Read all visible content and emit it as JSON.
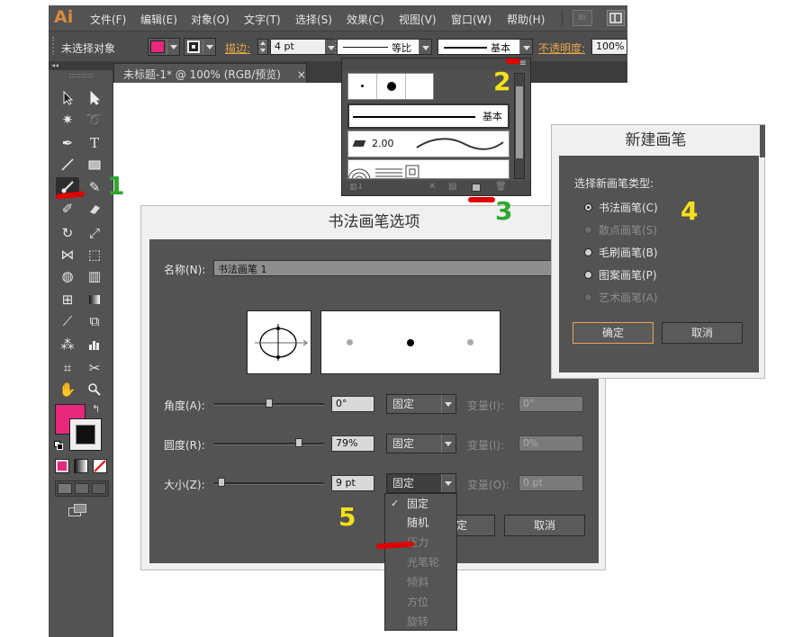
{
  "menubar": {
    "logo": "Ai",
    "items": [
      "文件(F)",
      "编辑(E)",
      "对象(O)",
      "文字(T)",
      "选择(S)",
      "效果(C)",
      "视图(V)",
      "窗口(W)",
      "帮助(H)"
    ],
    "bridge_label": "Br"
  },
  "controlbar": {
    "selection_status": "未选择对象",
    "stroke_label": "描边:",
    "stroke_weight": "4 pt",
    "profile_label": "等比",
    "brush_label": "基本",
    "opacity_label": "不透明度:",
    "opacity_value": "100%",
    "fill_color": "#e8287c"
  },
  "document": {
    "tab_title": "未标题-1* @ 100% (RGB/预览)",
    "close_glyph": "×"
  },
  "brush_panel": {
    "basic_label": "基本",
    "stroke_value": "2.00",
    "menu_glyph": "≡"
  },
  "calligraphic_dialog": {
    "title": "书法画笔选项",
    "name_label": "名称(N):",
    "name_value": "书法画笔 1",
    "angle": {
      "label": "角度(A):",
      "value": "0°",
      "mode": "固定",
      "variation_label": "变量(I):",
      "variation_value": "0°",
      "slider_level": 0.5
    },
    "roundness": {
      "label": "圆度(R):",
      "value": "79%",
      "mode": "固定",
      "variation_label": "变量(I):",
      "variation_value": "0%",
      "slider_level": 0.79
    },
    "size": {
      "label": "大小(Z):",
      "value": "9 pt",
      "mode": "固定",
      "variation_label": "变量(O):",
      "variation_value": "0 pt",
      "slider_level": 0.04
    },
    "ok_partial": "定",
    "cancel_button": "取消",
    "size_menu": {
      "options": [
        "固定",
        "随机",
        "压力",
        "光笔轮",
        "倾斜",
        "方位",
        "旋转"
      ],
      "selected_index": 0,
      "enabled_count": 2,
      "check_glyph": "✓"
    }
  },
  "new_brush_dialog": {
    "title": "新建画笔",
    "prompt": "选择新画笔类型:",
    "options": [
      {
        "label": "书法画笔(C)",
        "enabled": true,
        "checked": true
      },
      {
        "label": "散点画笔(S)",
        "enabled": false,
        "checked": false
      },
      {
        "label": "毛刷画笔(B)",
        "enabled": true,
        "checked": false
      },
      {
        "label": "图案画笔(P)",
        "enabled": true,
        "checked": false
      },
      {
        "label": "艺术画笔(A)",
        "enabled": false,
        "checked": false
      }
    ],
    "ok_button": "确定",
    "cancel_button": "取消"
  },
  "annotations": {
    "step1": "1",
    "step2": "2",
    "step3": "3",
    "step4": "4",
    "step5": "5",
    "green": "#2fa82f",
    "yellow": "#f5e11a",
    "red": "#e00000"
  },
  "toolbar": {
    "fill_color": "#e8287c",
    "stroke_color": "#111111",
    "tools": [
      "selection-tool",
      "direct-selection-tool",
      "magic-wand-tool",
      "lasso-tool",
      "pen-tool",
      "type-tool",
      "line-tool",
      "rectangle-tool",
      "paintbrush-tool",
      "pencil-tool",
      "blob-brush-tool",
      "eraser-tool",
      "rotate-tool",
      "scale-tool",
      "width-tool",
      "free-transform-tool",
      "shape-builder-tool",
      "perspective-grid-tool",
      "mesh-tool",
      "gradient-tool",
      "eyedropper-tool",
      "blend-tool",
      "symbol-sprayer-tool",
      "column-graph-tool",
      "artboard-tool",
      "slice-tool",
      "hand-tool",
      "zoom-tool"
    ]
  }
}
